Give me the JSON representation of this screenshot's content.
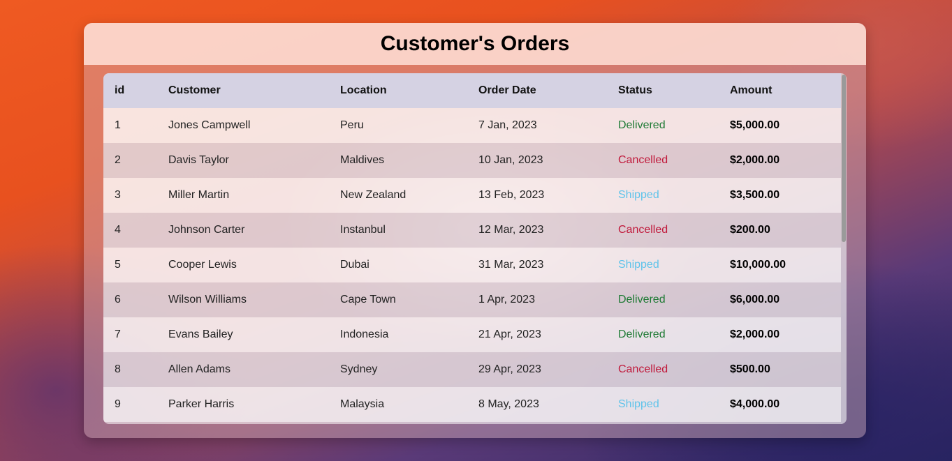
{
  "header": {
    "title": "Customer's Orders"
  },
  "table": {
    "columns": [
      "id",
      "Customer",
      "Location",
      "Order Date",
      "Status",
      "Amount"
    ],
    "rows": [
      {
        "id": "1",
        "customer": "Jones Campwell",
        "location": "Peru",
        "date": "7 Jan, 2023",
        "status": "Delivered",
        "amount": "$5,000.00"
      },
      {
        "id": "2",
        "customer": "Davis Taylor",
        "location": "Maldives",
        "date": "10 Jan, 2023",
        "status": "Cancelled",
        "amount": "$2,000.00"
      },
      {
        "id": "3",
        "customer": "Miller Martin",
        "location": "New Zealand",
        "date": "13 Feb, 2023",
        "status": "Shipped",
        "amount": "$3,500.00"
      },
      {
        "id": "4",
        "customer": "Johnson Carter",
        "location": "Instanbul",
        "date": "12 Mar, 2023",
        "status": "Cancelled",
        "amount": "$200.00"
      },
      {
        "id": "5",
        "customer": "Cooper Lewis",
        "location": "Dubai",
        "date": "31 Mar, 2023",
        "status": "Shipped",
        "amount": "$10,000.00"
      },
      {
        "id": "6",
        "customer": "Wilson Williams",
        "location": "Cape Town",
        "date": "1 Apr, 2023",
        "status": "Delivered",
        "amount": "$6,000.00"
      },
      {
        "id": "7",
        "customer": "Evans Bailey",
        "location": "Indonesia",
        "date": "21 Apr, 2023",
        "status": "Delivered",
        "amount": "$2,000.00"
      },
      {
        "id": "8",
        "customer": "Allen Adams",
        "location": "Sydney",
        "date": "29 Apr, 2023",
        "status": "Cancelled",
        "amount": "$500.00"
      },
      {
        "id": "9",
        "customer": "Parker Harris",
        "location": "Malaysia",
        "date": "8 May, 2023",
        "status": "Shipped",
        "amount": "$4,000.00"
      }
    ]
  },
  "colors": {
    "delivered": "#1e7a34",
    "cancelled": "#c0183a",
    "shipped": "#5ec3ea",
    "header_bg": "#d5d2e3"
  }
}
